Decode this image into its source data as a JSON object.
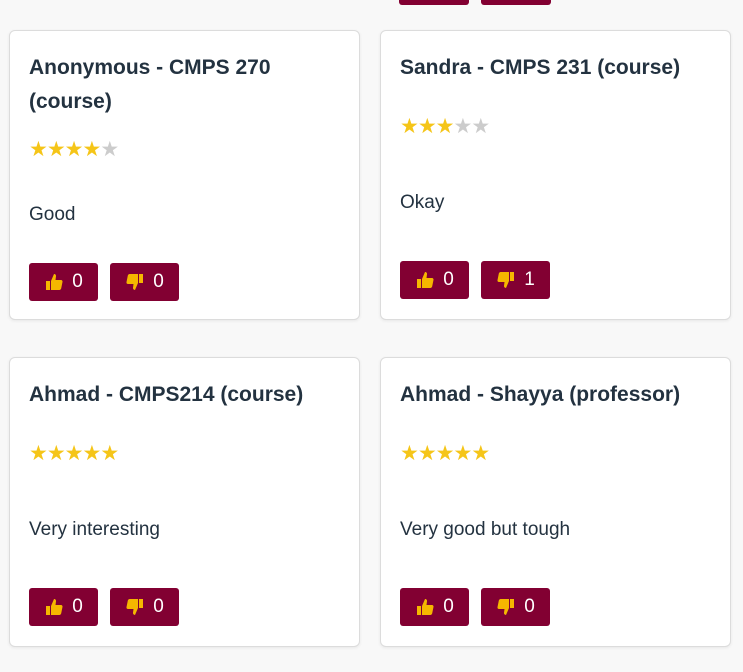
{
  "colors": {
    "button_bg": "#820032",
    "star_filled": "#f5c518",
    "star_empty": "#cccccc",
    "text": "#233240"
  },
  "reviews": [
    {
      "title": "Anonymous - CMPS 270 (course)",
      "rating": 4,
      "max_rating": 5,
      "stars_display": "★★★★★",
      "comment": "Good",
      "likes": "0",
      "dislikes": "0",
      "like_icon": "thumbs-up-icon",
      "dislike_icon": "thumbs-down-icon"
    },
    {
      "title": "Sandra - CMPS 231 (course)",
      "rating": 3,
      "max_rating": 5,
      "stars_display": "★★★★★",
      "comment": "Okay",
      "likes": "0",
      "dislikes": "1",
      "like_icon": "thumbs-up-icon",
      "dislike_icon": "thumbs-down-icon"
    },
    {
      "title": "Ahmad - CMPS214 (course)",
      "rating": 5,
      "max_rating": 5,
      "stars_display": "★★★★★",
      "comment": "Very interesting",
      "likes": "0",
      "dislikes": "0",
      "like_icon": "thumbs-up-icon",
      "dislike_icon": "thumbs-down-icon"
    },
    {
      "title": "Ahmad - Shayya (professor)",
      "rating": 5,
      "max_rating": 5,
      "stars_display": "★★★★★",
      "comment": "Very good but tough",
      "likes": "0",
      "dislikes": "0",
      "like_icon": "thumbs-up-icon",
      "dislike_icon": "thumbs-down-icon"
    }
  ]
}
